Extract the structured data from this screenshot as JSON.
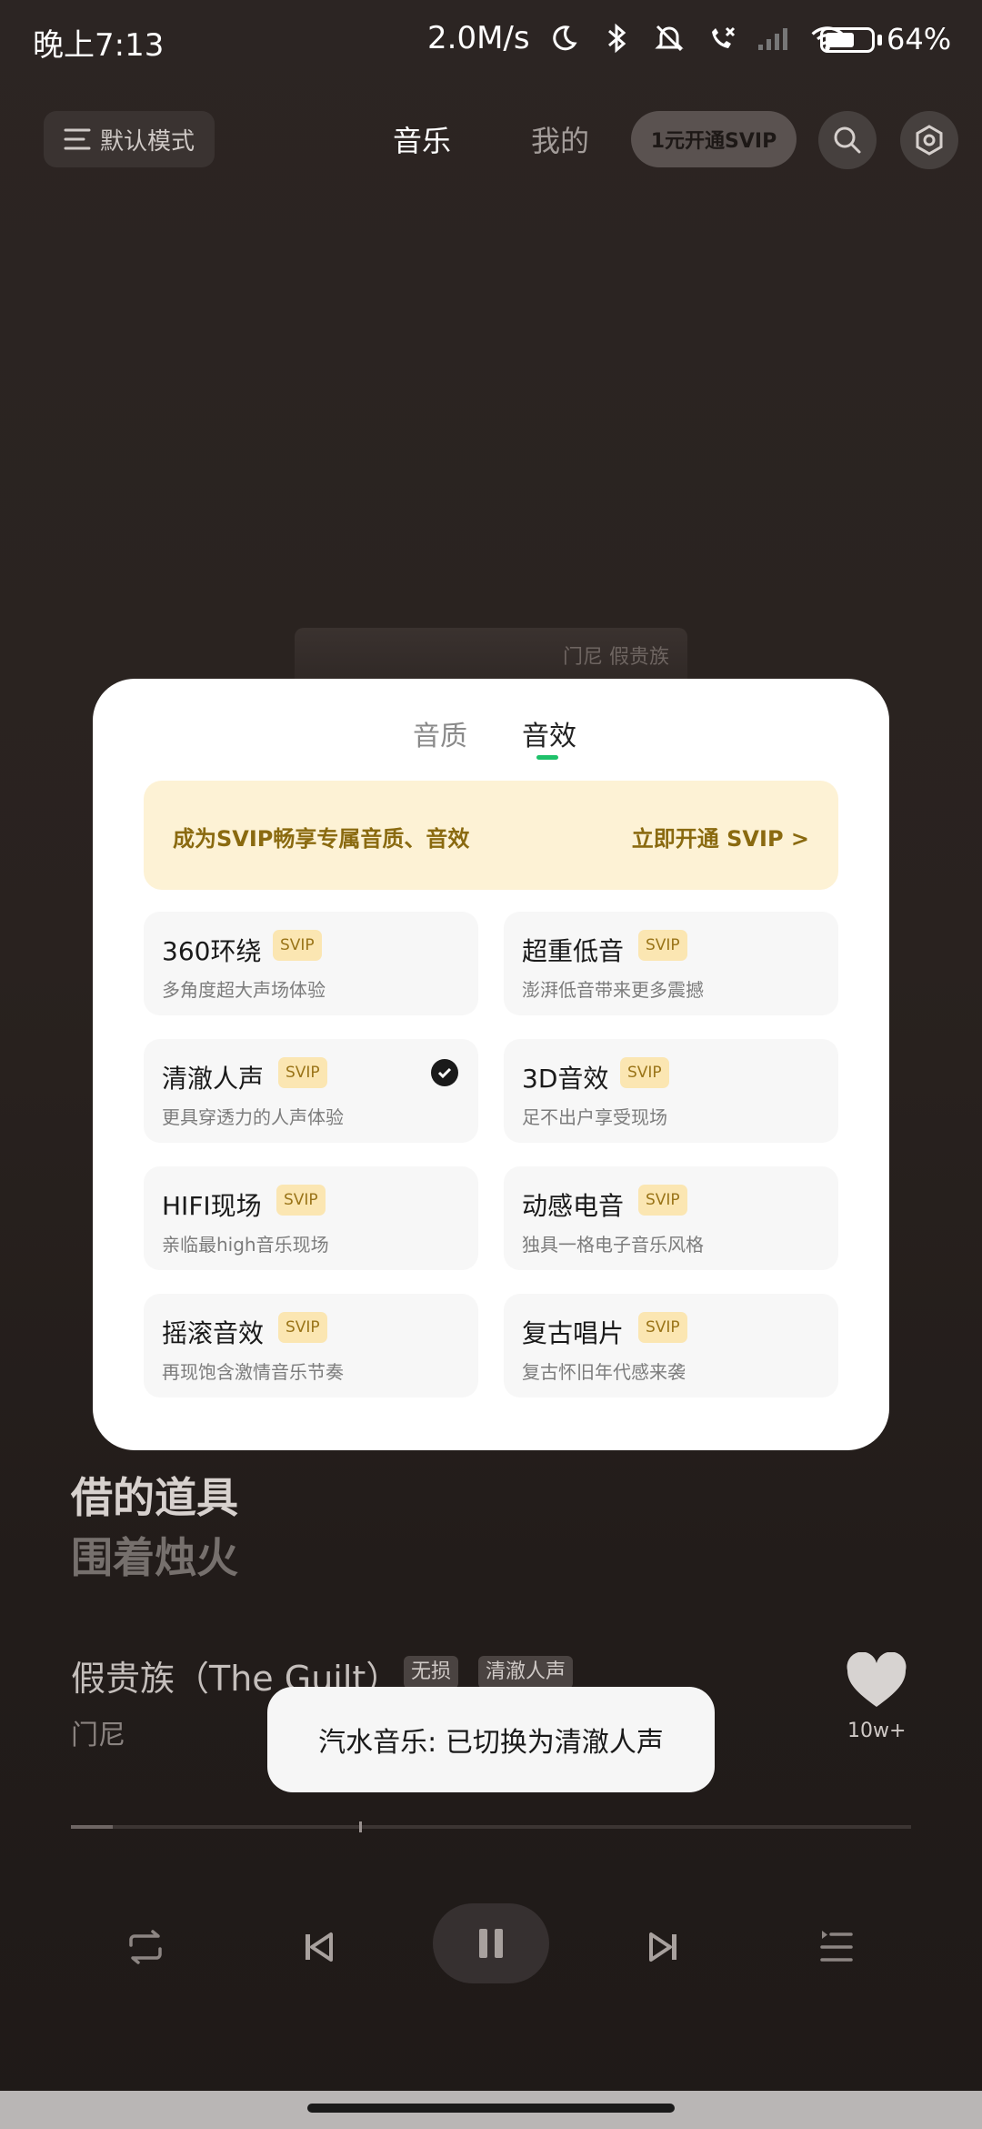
{
  "status_bar": {
    "time": "晚上7:13",
    "speed": "2.0M/s",
    "battery_pct": "64%",
    "battery_level": 0.64,
    "icons": [
      "moon-icon",
      "bluetooth-icon",
      "mute-bell-icon",
      "call-off-icon",
      "signal-icon",
      "wifi-icon"
    ]
  },
  "header": {
    "mode_label": "默认模式",
    "tab_music": "音乐",
    "tab_mine": "我的",
    "svip_label": "1元开通SVIP"
  },
  "album": {
    "art_text": "门尼 假贵族"
  },
  "sheet": {
    "tab_quality": "音质",
    "tab_effect": "音效",
    "active_tab": "音效",
    "banner_left": "成为SVIP畅享专属音质、音效",
    "banner_right": "立即开通 SVIP >",
    "effects": [
      {
        "name": "360环绕",
        "badge": "SVIP",
        "desc": "多角度超大声场体验",
        "selected": false
      },
      {
        "name": "超重低音",
        "badge": "SVIP",
        "desc": "澎湃低音带来更多震撼",
        "selected": false
      },
      {
        "name": "清澈人声",
        "badge": "SVIP",
        "desc": "更具穿透力的人声体验",
        "selected": true
      },
      {
        "name": "3D音效",
        "badge": "SVIP",
        "desc": "足不出户享受现场",
        "selected": false
      },
      {
        "name": "HIFI现场",
        "badge": "SVIP",
        "desc": "亲临最high音乐现场",
        "selected": false
      },
      {
        "name": "动感电音",
        "badge": "SVIP",
        "desc": "独具一格电子音乐风格",
        "selected": false
      },
      {
        "name": "摇滚音效",
        "badge": "SVIP",
        "desc": "再现饱含激情音乐节奏",
        "selected": false
      },
      {
        "name": "复古唱片",
        "badge": "SVIP",
        "desc": "复古怀旧年代感来袭",
        "selected": false
      }
    ]
  },
  "lyrics": {
    "line1": "借的道具",
    "line2": "围着烛火"
  },
  "song": {
    "title": "假贵族（The Guilt）",
    "tag_lossless": "无损",
    "tag_effect": "清澈人声",
    "artist": "门尼",
    "likes": "10w+"
  },
  "toast": "汽水音乐: 已切换为清澈人声",
  "progress": {
    "played_fraction": 0.05,
    "buffered_fraction": 0.34
  },
  "colors": {
    "accent": "#1ec16a",
    "svip_gold": "#8a6a10",
    "badge_bg": "#fbe6b2"
  }
}
